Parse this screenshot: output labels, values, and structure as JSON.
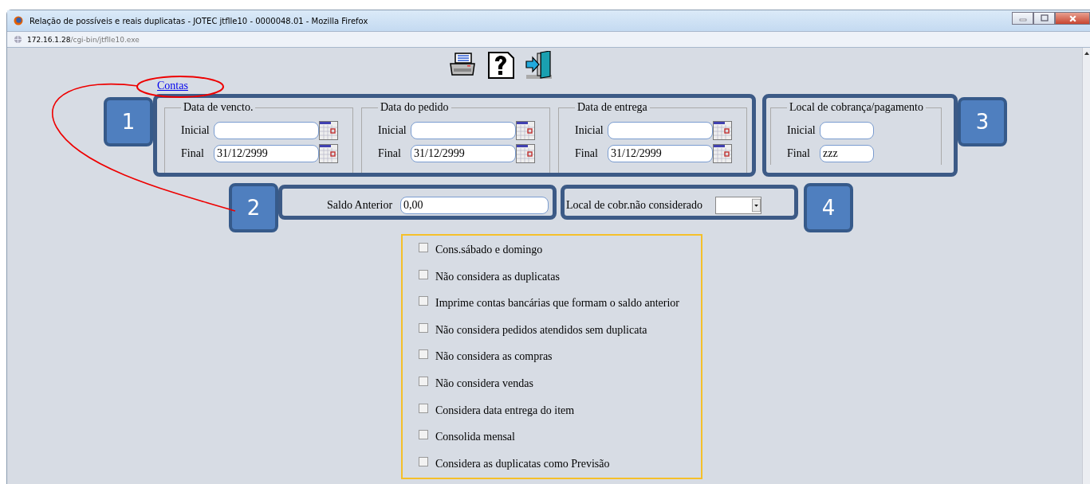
{
  "window": {
    "title": "Relação de possíveis e reais duplicatas - JOTEC jtflle10 - 0000048.01 - Mozilla Firefox",
    "address_host": "172.16.1.28",
    "address_path": "/cgi-bin/jtflle10.exe"
  },
  "toolbar": [
    {
      "kind": "print"
    },
    {
      "kind": "help"
    },
    {
      "kind": "exit"
    }
  ],
  "link": "Contas",
  "date_groups": [
    {
      "legend": "Data de vencto.",
      "fields": [
        {
          "label": "Inicial"
        },
        {
          "label": "Final",
          "value": "31/12/2999"
        }
      ]
    },
    {
      "legend": "Data do pedido",
      "fields": [
        {
          "label": "Inicial"
        },
        {
          "label": "Final",
          "value": "31/12/2999"
        }
      ]
    },
    {
      "legend": "Data de entrega",
      "fields": [
        {
          "label": "Inicial"
        },
        {
          "label": "Final",
          "value": "31/12/2999"
        }
      ]
    }
  ],
  "local_group": {
    "legend": "Local de cobrança/pagamento",
    "fields": [
      {
        "label": "Inicial"
      },
      {
        "label": "Final",
        "value": "zzz"
      }
    ]
  },
  "saldo": {
    "label": "Saldo Anterior",
    "value": "0,00"
  },
  "local_excluded": {
    "label": "Local de cobr.não considerado"
  },
  "options": [
    {
      "label": "Cons.sábado e domingo",
      "checked": false
    },
    {
      "label": "Não considera as duplicatas",
      "checked": false
    },
    {
      "label": "Imprime contas bancárias que formam o saldo anterior",
      "checked": false
    },
    {
      "label": "Não considera pedidos atendidos sem duplicata",
      "checked": false
    },
    {
      "label": "Não considera as compras",
      "checked": false
    },
    {
      "label": "Não considera vendas",
      "checked": false
    },
    {
      "label": "Considera data entrega do item",
      "checked": false
    },
    {
      "label": "Consolida mensal",
      "checked": false
    },
    {
      "label": "Considera as duplicatas como Previsão",
      "checked": false
    }
  ],
  "callouts": [
    "1",
    "2",
    "3",
    "4"
  ]
}
